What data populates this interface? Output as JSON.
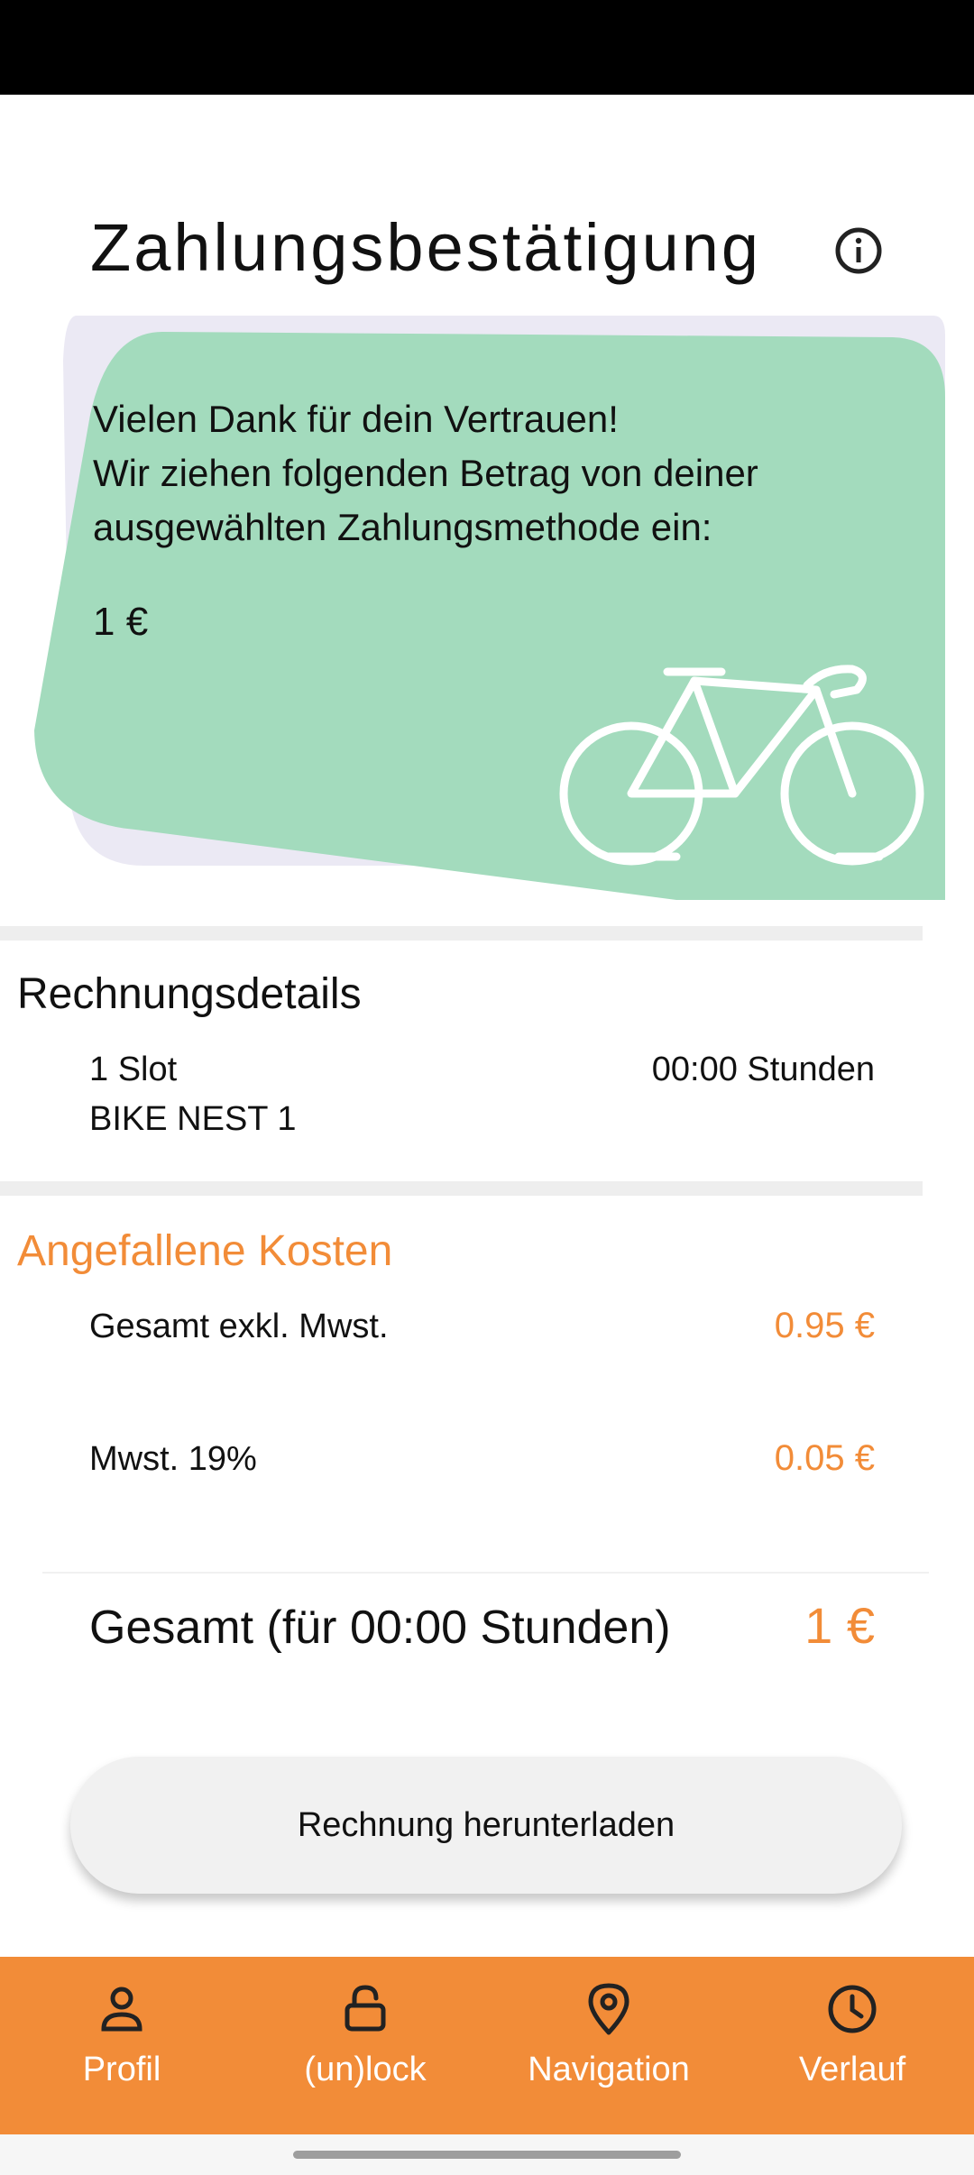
{
  "header": {
    "title": "Zahlungsbestätigung",
    "info_icon": "info-circle-icon"
  },
  "confirmation_card": {
    "line1": "Vielen Dank für dein Vertrauen!",
    "line2": "Wir ziehen folgenden Betrag von deiner",
    "line3": "ausgewählten Zahlungsmethode ein:",
    "amount": "1 €",
    "icon": "bicycle-icon",
    "colors": {
      "front_shape": "#a3dbbd",
      "back_shape": "#ebe9f4"
    }
  },
  "invoice_details": {
    "title": "Rechnungsdetails",
    "slot": "1 Slot",
    "duration": "00:00 Stunden",
    "location": "BIKE NEST 1"
  },
  "costs": {
    "title": "Angefallene Kosten",
    "net_label": "Gesamt exkl. Mwst.",
    "net_value": "0.95 €",
    "vat_label": "Mwst. 19%",
    "vat_value": "0.05 €",
    "total_label": "Gesamt (für 00:00 Stunden)",
    "total_value": "1 €"
  },
  "download_button": {
    "label": "Rechnung herunterladen"
  },
  "bottom_nav": {
    "items": [
      {
        "label": "Profil",
        "icon": "person-icon"
      },
      {
        "label": "(un)lock",
        "icon": "lock-icon"
      },
      {
        "label": "Navigation",
        "icon": "location-pin-icon"
      },
      {
        "label": "Verlauf",
        "icon": "clock-icon"
      }
    ]
  },
  "theme": {
    "accent": "#f28c38",
    "divider": "#eeeeee",
    "button_bg": "#f1f1f1"
  }
}
